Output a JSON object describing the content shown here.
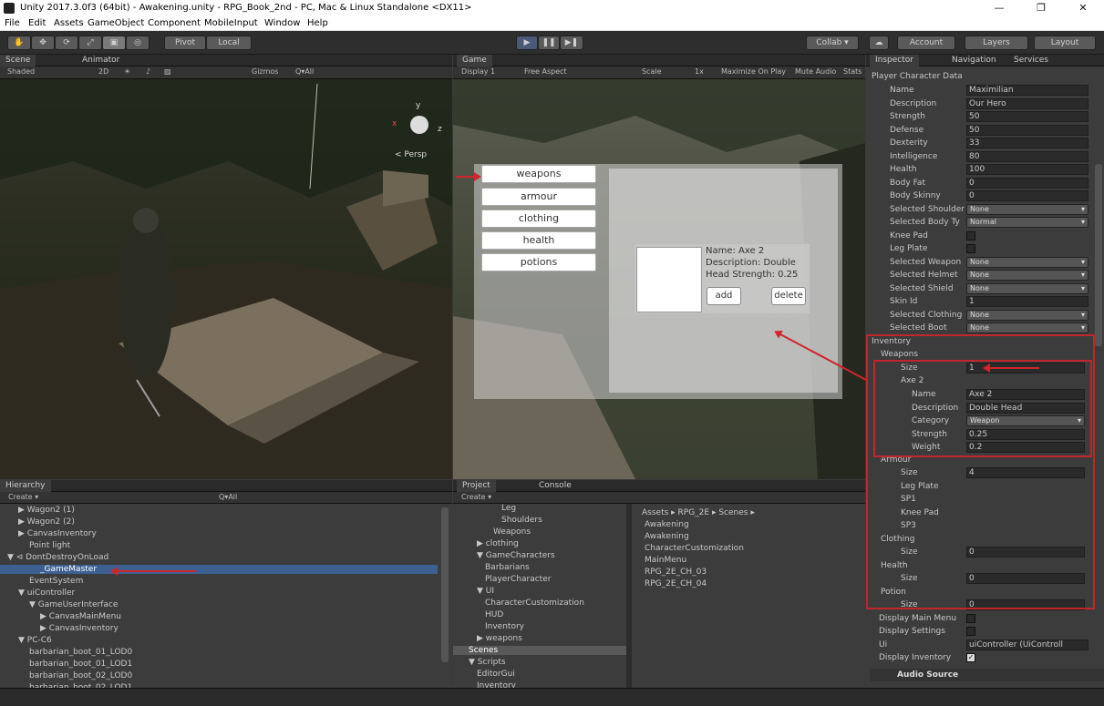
{
  "window": {
    "title": "Unity 2017.3.0f3 (64bit) - Awakening.unity - RPG_Book_2nd - PC, Mac & Linux Standalone <DX11>",
    "minimize": "—",
    "maximize": "❐",
    "close": "✕"
  },
  "menu": [
    "File",
    "Edit",
    "Assets",
    "GameObject",
    "Component",
    "MobileInput",
    "Window",
    "Help"
  ],
  "toolbar": {
    "pivot": "Pivot",
    "local": "Local",
    "collab": "Collab ▾",
    "account": "Account",
    "layers": "Layers",
    "layout": "Layout"
  },
  "scene": {
    "tab": "Scene",
    "tab2": "Animator",
    "shading": "Shaded",
    "mode2d": "2D",
    "gizmos": "Gizmos",
    "search": "Q▾All",
    "persp": "< Persp",
    "axis_y": "y",
    "axis_x": "x",
    "axis_z": "z"
  },
  "game": {
    "tab": "Game",
    "display": "Display 1",
    "aspect": "Free Aspect",
    "scale": "Scale",
    "scale_val": "1x",
    "maximize": "Maximize On Play",
    "mute": "Mute Audio",
    "stats": "Stats",
    "categories": [
      "weapons",
      "armour",
      "clothing",
      "health",
      "potions"
    ],
    "item": {
      "name": "Name: Axe 2",
      "description": "Description: Double",
      "line3": "Head  Strength: 0.25",
      "add": "add",
      "delete": "delete"
    }
  },
  "inspector": {
    "tabs": [
      "Inspector",
      "Navigation",
      "Services"
    ],
    "component": "Player Character Data",
    "fields": [
      {
        "label": "Name",
        "value": "Maximilian",
        "kind": "text"
      },
      {
        "label": "Description",
        "value": "Our Hero",
        "kind": "text"
      },
      {
        "label": "Strength",
        "value": "50",
        "kind": "text"
      },
      {
        "label": "Defense",
        "value": "50",
        "kind": "text"
      },
      {
        "label": "Dexterity",
        "value": "33",
        "kind": "text"
      },
      {
        "label": "Intelligence",
        "value": "80",
        "kind": "text"
      },
      {
        "label": "Health",
        "value": "100",
        "kind": "text"
      },
      {
        "label": "Body Fat",
        "value": "0",
        "kind": "text"
      },
      {
        "label": "Body Skinny",
        "value": "0",
        "kind": "text"
      },
      {
        "label": "Selected Shoulder",
        "value": "None",
        "kind": "drop"
      },
      {
        "label": "Selected Body Ty",
        "value": "Normal",
        "kind": "drop"
      },
      {
        "label": "Knee Pad",
        "value": "",
        "kind": "chk"
      },
      {
        "label": "Leg Plate",
        "value": "",
        "kind": "chk"
      },
      {
        "label": "Selected Weapon",
        "value": "None",
        "kind": "drop"
      },
      {
        "label": "Selected Helmet",
        "value": "None",
        "kind": "drop"
      },
      {
        "label": "Selected Shield",
        "value": "None",
        "kind": "drop"
      },
      {
        "label": "Skin Id",
        "value": "1",
        "kind": "text"
      },
      {
        "label": "Selected Clothing",
        "value": "None",
        "kind": "drop"
      },
      {
        "label": "Selected Boot",
        "value": "None",
        "kind": "drop"
      }
    ],
    "inventory": {
      "label": "Inventory",
      "weapons": "Weapons",
      "size": "Size",
      "weapons_size": "1",
      "axe": "Axe 2",
      "axe_fields": [
        {
          "label": "Name",
          "value": "Axe 2",
          "kind": "text"
        },
        {
          "label": "Description",
          "value": "Double Head",
          "kind": "text"
        },
        {
          "label": "Category",
          "value": "Weapon",
          "kind": "drop"
        },
        {
          "label": "Strength",
          "value": "0.25",
          "kind": "text"
        },
        {
          "label": "Weight",
          "value": "0.2",
          "kind": "text"
        }
      ],
      "armour": "Armour",
      "armour_size": "4",
      "armour_items": [
        "Leg Plate",
        "SP1",
        "Knee Pad",
        "SP3"
      ],
      "clothing": "Clothing",
      "clothing_size": "0",
      "health": "Health",
      "health_size": "0",
      "potion": "Potion",
      "potion_size": "0"
    },
    "display_main_menu": "Display Main Menu",
    "display_settings": "Display Settings",
    "ui_label": "Ui",
    "ui_value": "uiController (UiControll",
    "display_inventory": "Display Inventory",
    "audio_source": "Audio Source"
  },
  "hierarchy": {
    "tab": "Hierarchy",
    "create": "Create ▾",
    "search": "Q▾All",
    "items": [
      {
        "text": "▶ Wagon2 (1)",
        "indent": 1
      },
      {
        "text": "▶ Wagon2 (2)",
        "indent": 1
      },
      {
        "text": "▶ CanvasInventory",
        "indent": 1
      },
      {
        "text": "Point light",
        "indent": 2
      },
      {
        "text": "▼ ⊲ DontDestroyOnLoad",
        "indent": 0
      },
      {
        "text": "_GameMaster",
        "indent": 3
      },
      {
        "text": "EventSystem",
        "indent": 2
      },
      {
        "text": "▼ uiController",
        "indent": 1
      },
      {
        "text": "▼ GameUserInterface",
        "indent": 2
      },
      {
        "text": "▶ CanvasMainMenu",
        "indent": 3
      },
      {
        "text": "▶ CanvasInventory",
        "indent": 3
      },
      {
        "text": "▼ PC-C6",
        "indent": 1
      },
      {
        "text": "barbarian_boot_01_LOD0",
        "indent": 2
      },
      {
        "text": "barbarian_boot_01_LOD1",
        "indent": 2
      },
      {
        "text": "barbarian_boot_02_LOD0",
        "indent": 2
      },
      {
        "text": "barbarian_boot_02_LOD1",
        "indent": 2
      }
    ]
  },
  "project": {
    "tab": "Project",
    "tab2": "Console",
    "create": "Create ▾",
    "breadcrumb": "Assets ▸ RPG_2E ▸ Scenes ▸",
    "tree": [
      {
        "text": "Leg",
        "indent": 5
      },
      {
        "text": "Shoulders",
        "indent": 5
      },
      {
        "text": "Weapons",
        "indent": 4
      },
      {
        "text": "▶ clothing",
        "indent": 2
      },
      {
        "text": "▼ GameCharacters",
        "indent": 2
      },
      {
        "text": "Barbarians",
        "indent": 3
      },
      {
        "text": "PlayerCharacter",
        "indent": 3
      },
      {
        "text": "▼ UI",
        "indent": 2
      },
      {
        "text": "CharacterCustomization",
        "indent": 3
      },
      {
        "text": "HUD",
        "indent": 3
      },
      {
        "text": "Inventory",
        "indent": 3
      },
      {
        "text": "▶ weapons",
        "indent": 2
      },
      {
        "text": "Scenes",
        "indent": 1
      },
      {
        "text": "▼ Scripts",
        "indent": 1
      },
      {
        "text": "EditorGui",
        "indent": 2
      },
      {
        "text": "Inventory",
        "indent": 2
      }
    ],
    "files": [
      "Awakening",
      "Awakening",
      "CharacterCustomization",
      "MainMenu",
      "RPG_2E_CH_03",
      "RPG_2E_CH_04"
    ]
  },
  "colors": {
    "accent_red": "#c0262b",
    "selection": "#3d6092"
  }
}
